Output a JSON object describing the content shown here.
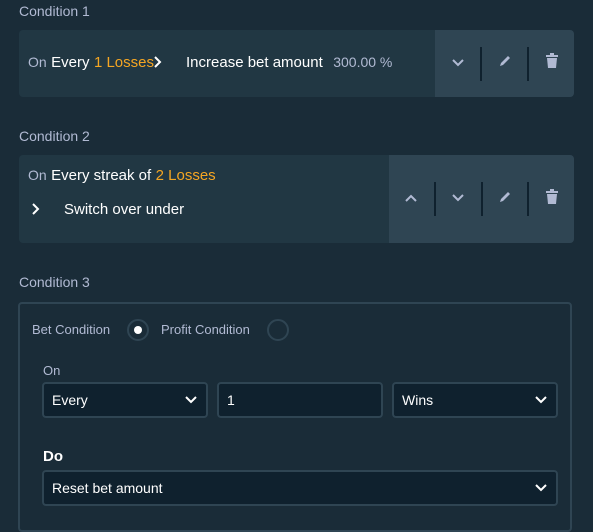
{
  "conditions": [
    {
      "label": "Condition 1",
      "on": "On",
      "every": "Every",
      "count_text": "1 Losses",
      "action": "Increase bet amount",
      "action_value": "300.00 %"
    },
    {
      "label": "Condition 2",
      "on": "On",
      "every": "Every streak of",
      "count_text": "2 Losses",
      "action": "Switch over under"
    },
    {
      "label": "Condition 3",
      "bet_condition_label": "Bet Condition",
      "bet_condition_selected": true,
      "profit_condition_label": "Profit Condition",
      "profit_condition_selected": false,
      "on_label": "On",
      "on_type_value": "Every",
      "on_count_value": "1",
      "on_result_value": "Wins",
      "do_label": "Do",
      "do_value": "Reset bet amount"
    }
  ],
  "icons": [
    "chevron-right-icon",
    "chevron-down-icon",
    "chevron-up-icon",
    "pencil-icon",
    "trash-icon"
  ],
  "colors": {
    "background": "#1a2c38",
    "card": "#213743",
    "actions": "#2f4553",
    "input": "#0f212e",
    "highlight": "#f5a623",
    "text": "#b1bad3",
    "text_strong": "#ffffff"
  }
}
